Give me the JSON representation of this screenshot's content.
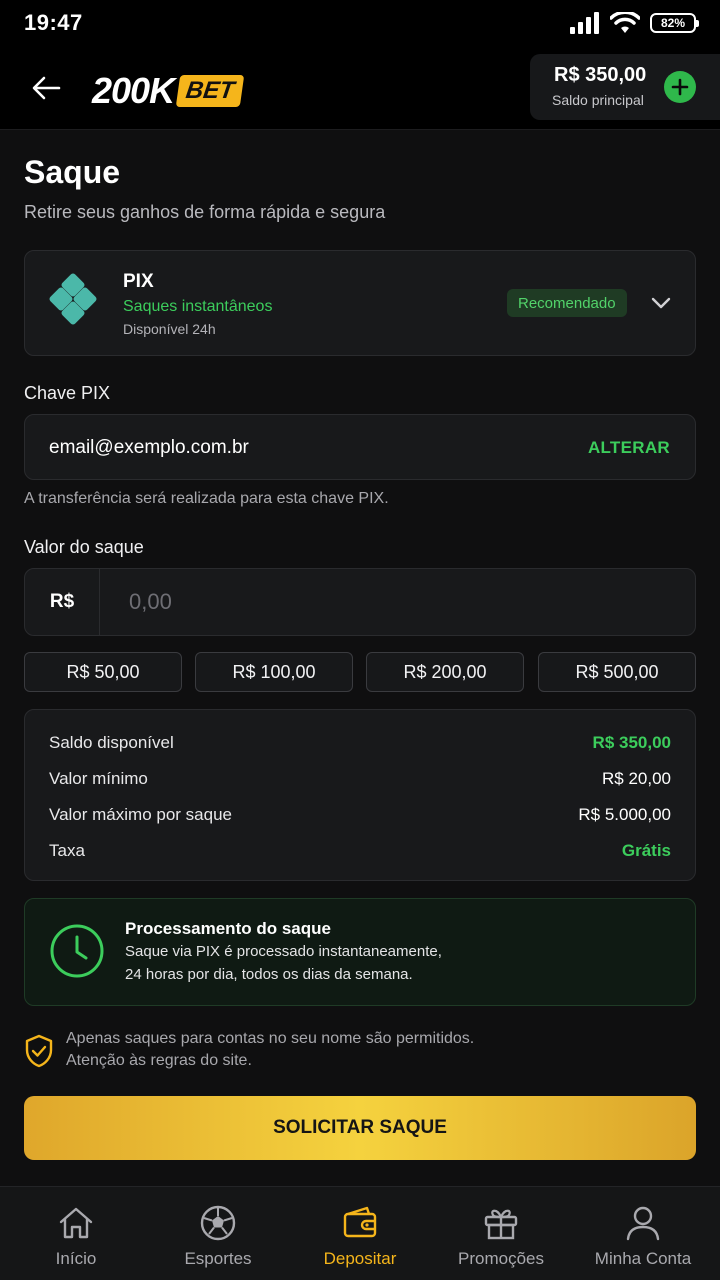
{
  "status_bar": {
    "time": "19:47",
    "battery": "82%"
  },
  "header": {
    "logo_number": "200K",
    "logo_bet": "BET",
    "balance_amount": "R$ 350,00",
    "balance_label": "Saldo principal"
  },
  "page": {
    "title": "Saque",
    "subtitle": "Retire seus ganhos de forma rápida e segura"
  },
  "method": {
    "name": "PIX",
    "subtitle": "Saques instantâneos",
    "availability": "Disponível 24h",
    "badge": "Recomendado",
    "icons": [
      "pix-icon",
      "chevron-down-icon"
    ]
  },
  "pix_key": {
    "label": "Chave PIX",
    "value": "email@exemplo.com.br",
    "change_label": "ALTERAR",
    "hint": "A transferência será realizada para esta chave PIX."
  },
  "amount": {
    "label": "Valor do saque",
    "currency": "R$",
    "placeholder": "0,00",
    "quick_values": [
      "R$ 50,00",
      "R$ 100,00",
      "R$ 200,00",
      "R$ 500,00"
    ]
  },
  "info": {
    "rows": [
      {
        "key": "Saldo disponível",
        "value": "R$ 350,00"
      },
      {
        "key": "Valor mínimo",
        "value": "R$ 20,00"
      },
      {
        "key": "Valor máximo por saque",
        "value": "R$ 5.000,00"
      },
      {
        "key": "Taxa",
        "value": "Grátis"
      }
    ]
  },
  "processing": {
    "title": "Processamento do saque",
    "line1": "Saque via PIX é processado instantaneamente,",
    "line2": "24 horas por dia, todos os dias da semana."
  },
  "warning": {
    "line1": "Apenas saques para contas no seu nome são permitidos.",
    "line2": "Atenção às regras do site."
  },
  "submit_label": "SOLICITAR SAQUE",
  "nav": [
    {
      "label": "Início",
      "icon": "home-icon"
    },
    {
      "label": "Esportes",
      "icon": "soccer-ball-icon"
    },
    {
      "label": "Depositar",
      "icon": "wallet-icon",
      "active": true
    },
    {
      "label": "Promoções",
      "icon": "gift-icon"
    },
    {
      "label": "Minha Conta",
      "icon": "user-icon"
    }
  ],
  "colors": {
    "accent_gold": "#f5b51b",
    "success_green": "#3ccd5c",
    "background": "#0f0f10",
    "card": "#18191b"
  }
}
